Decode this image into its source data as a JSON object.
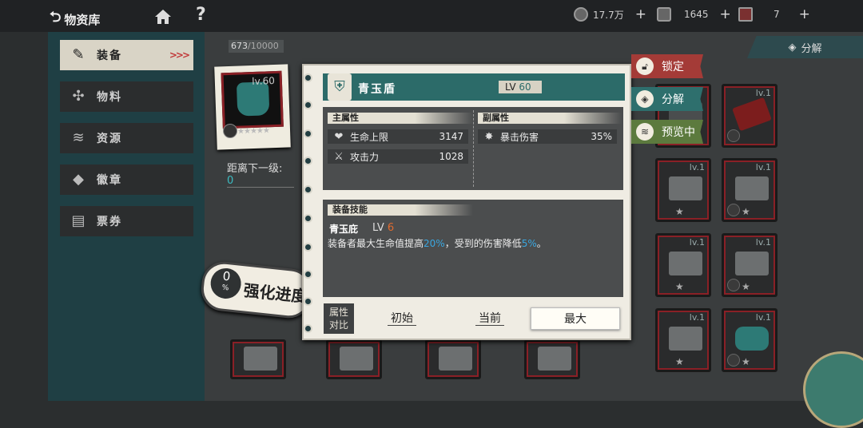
{
  "topbar": {
    "back_label": "物资库",
    "help_label": "?",
    "resources": [
      {
        "icon": "gear-coin-icon",
        "value": "17.7万",
        "plus": "+"
      },
      {
        "icon": "ticket-icon",
        "value": "1645",
        "plus": "+"
      },
      {
        "icon": "card-icon",
        "value": "7",
        "plus": "+"
      }
    ]
  },
  "sidebar": {
    "items": [
      {
        "label": "装备",
        "icon": "equipment-icon",
        "active": true,
        "arrows": ">>>"
      },
      {
        "label": "物料",
        "icon": "materials-icon"
      },
      {
        "label": "资源",
        "icon": "resources-icon"
      },
      {
        "label": "徽章",
        "icon": "badge-icon"
      },
      {
        "label": "票券",
        "icon": "coupon-icon"
      }
    ]
  },
  "inventory": {
    "count": "673",
    "capacity": "/10000",
    "decompose_label": "分解",
    "card_level": "lv.1"
  },
  "equip_card": {
    "level": "lv.60",
    "next_level_label": "距离下一级:",
    "next_level_value": "0",
    "progress_value": "0",
    "progress_unit": "%",
    "progress_label": "强化进度"
  },
  "detail": {
    "name": "青玉盾",
    "lv_label": "LV",
    "lv_value": "60",
    "main_attr_title": "主属性",
    "main_attrs": [
      {
        "icon": "heart-icon",
        "name": "生命上限",
        "value": "3147"
      },
      {
        "icon": "crossed-swords-icon",
        "name": "攻击力",
        "value": "1028"
      }
    ],
    "sub_attr_title": "副属性",
    "sub_attrs": [
      {
        "icon": "burst-icon",
        "name": "暴击伤害",
        "value": "35%"
      }
    ],
    "skill_title": "装备技能",
    "skill_name": "青玉庇",
    "skill_lv_label": "LV",
    "skill_lv_value": "6",
    "skill_desc_1": "装备者最大生命值提高",
    "skill_hl_1": "20%",
    "skill_desc_2": "，受到的伤害降低",
    "skill_hl_2": "5%",
    "skill_desc_3": "。",
    "compare_label_1": "属性",
    "compare_label_2": "对比",
    "compare_options": [
      "初始",
      "当前",
      "最大"
    ]
  },
  "side_tabs": {
    "lock": "锁定",
    "decompose": "分解",
    "preview": "预览中"
  },
  "colors": {
    "teal": "#2c6b69",
    "red": "#a43b37",
    "green": "#5c7a3e",
    "highlight_blue": "#3aa7e0",
    "skill_level_orange": "#e06b2f",
    "next_level_cyan": "#3bbcc2"
  }
}
